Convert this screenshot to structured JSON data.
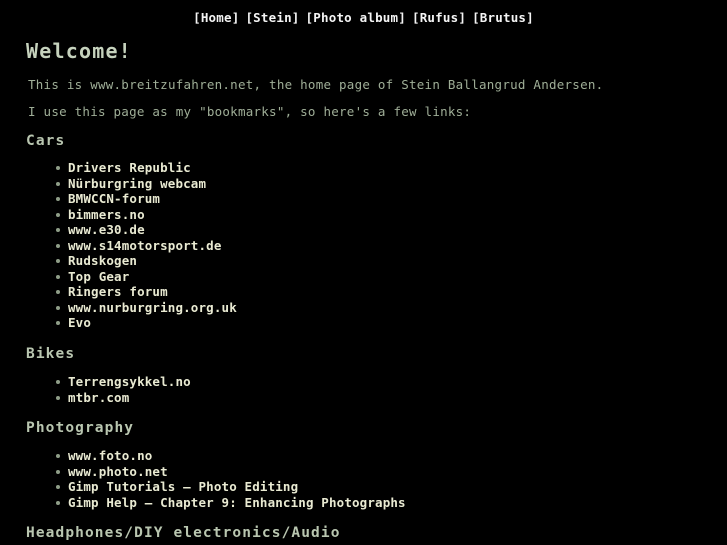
{
  "nav": {
    "items": [
      {
        "label": "[Home]"
      },
      {
        "label": "[Stein]"
      },
      {
        "label": "[Photo album]"
      },
      {
        "label": "[Rufus]"
      },
      {
        "label": "[Brutus]"
      }
    ]
  },
  "page": {
    "title": "Welcome!",
    "paragraph1": "This is www.breitzufahren.net, the home page of Stein Ballangrud Andersen.",
    "paragraph2": "I use this page as my \"bookmarks\", so here's a few links:"
  },
  "sections": {
    "cars": {
      "heading": "Cars",
      "items": [
        "Drivers Republic",
        "Nürburgring webcam",
        "BMWCCN-forum",
        "bimmers.no",
        "www.e30.de",
        "www.s14motorsport.de",
        "Rudskogen",
        "Top Gear",
        "Ringers forum",
        "www.nurburgring.org.uk",
        "Evo"
      ]
    },
    "bikes": {
      "heading": "Bikes",
      "items": [
        "Terrengsykkel.no",
        "mtbr.com"
      ]
    },
    "photography": {
      "heading": "Photography",
      "items": [
        "www.foto.no",
        "www.photo.net",
        "Gimp Tutorials – Photo Editing",
        "Gimp Help – Chapter 9: Enhancing Photographs"
      ]
    },
    "audio": {
      "heading": "Headphones/DIY electronics/Audio"
    }
  },
  "colors": {
    "background": "#000000",
    "nav_link": "#f4f4f4",
    "heading": "#b9c6b0",
    "body_text": "#9fae97",
    "list_link": "#e9ead2",
    "bullet": "#8f9e88"
  }
}
